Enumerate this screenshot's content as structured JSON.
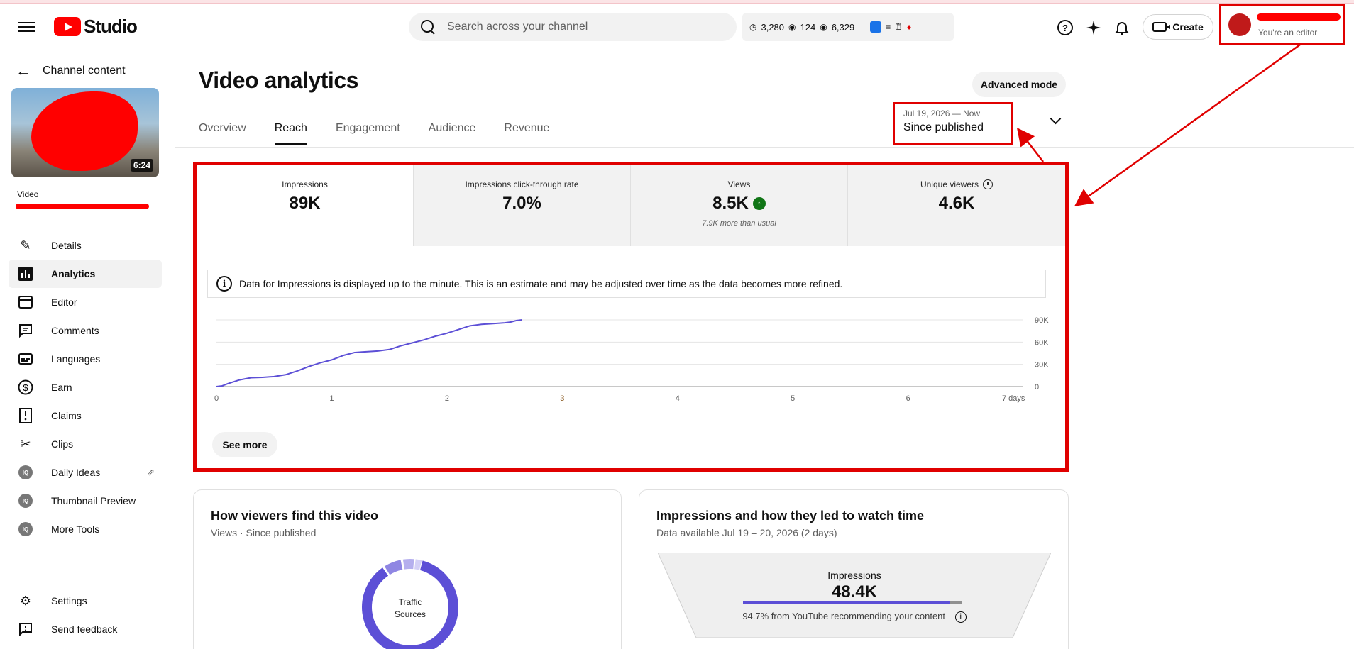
{
  "header": {
    "app_name": "Studio",
    "search_placeholder": "Search across your channel",
    "stats": {
      "watch_hours": "3,280",
      "live_viewers": "124",
      "views": "6,329"
    },
    "create_label": "Create",
    "account_role": "You're an editor"
  },
  "sidebar": {
    "back_label": "Channel content",
    "thumb_duration": "6:24",
    "video_label": "Video",
    "items": [
      {
        "label": "Details",
        "icon": "pencil-icon"
      },
      {
        "label": "Analytics",
        "icon": "analytics-icon"
      },
      {
        "label": "Editor",
        "icon": "editor-icon"
      },
      {
        "label": "Comments",
        "icon": "comments-icon"
      },
      {
        "label": "Languages",
        "icon": "subtitles-icon"
      },
      {
        "label": "Earn",
        "icon": "dollar-icon"
      },
      {
        "label": "Claims",
        "icon": "claims-icon"
      },
      {
        "label": "Clips",
        "icon": "scissors-icon"
      },
      {
        "label": "Daily Ideas",
        "icon": "tool-icon"
      },
      {
        "label": "Thumbnail Preview",
        "icon": "tool-icon"
      },
      {
        "label": "More Tools",
        "icon": "tool-icon"
      }
    ],
    "bottom_items": [
      {
        "label": "Settings",
        "icon": "gear-icon"
      },
      {
        "label": "Send feedback",
        "icon": "feedback-icon"
      }
    ]
  },
  "main": {
    "title": "Video analytics",
    "advanced_mode": "Advanced mode",
    "tabs": [
      "Overview",
      "Reach",
      "Engagement",
      "Audience",
      "Revenue"
    ],
    "active_tab": "Reach",
    "date_range": "Jul 19, 2026 — Now",
    "date_selection": "Since published",
    "metrics": [
      {
        "label": "Impressions",
        "value": "89K",
        "sub": ""
      },
      {
        "label": "Impressions click-through rate",
        "value": "7.0%",
        "sub": ""
      },
      {
        "label": "Views",
        "value": "8.5K",
        "sub": "7.9K more than usual"
      },
      {
        "label": "Unique viewers",
        "value": "4.6K",
        "sub": ""
      }
    ],
    "info_text": "Data for Impressions is displayed up to the minute. This is an estimate and may be adjusted over time as the data becomes more refined.",
    "see_more": "See more"
  },
  "chart_data": {
    "type": "line",
    "title": "",
    "xlabel": "",
    "ylabel": "",
    "x_ticks": [
      "0",
      "1",
      "2",
      "3",
      "4",
      "5",
      "6",
      "7 days"
    ],
    "y_ticks": [
      "0",
      "30K",
      "60K",
      "90K"
    ],
    "xlim": [
      0,
      7
    ],
    "ylim": [
      0,
      90000
    ],
    "series": [
      {
        "x": [
          0,
          0.05,
          0.1,
          0.2,
          0.3,
          0.4,
          0.5,
          0.6,
          0.7,
          0.8,
          0.9,
          1.0,
          1.1,
          1.2,
          1.3,
          1.4,
          1.5,
          1.6,
          1.7,
          1.8,
          1.9,
          2.0,
          2.1,
          2.2,
          2.25,
          2.3,
          2.4,
          2.5,
          2.55,
          2.6,
          2.65
        ],
        "y": [
          0,
          1000,
          4000,
          9000,
          12000,
          12500,
          13500,
          16000,
          21000,
          27000,
          32000,
          36000,
          42000,
          46000,
          47000,
          48000,
          50000,
          55000,
          59000,
          63000,
          68000,
          72000,
          77000,
          82000,
          83000,
          84000,
          85000,
          86000,
          87000,
          89000,
          90000
        ]
      }
    ],
    "grid": true
  },
  "cards": {
    "traffic": {
      "title": "How viewers find this video",
      "subtitle": "Views · Since published",
      "donut_label_1": "Traffic",
      "donut_label_2": "Sources"
    },
    "impressions": {
      "title": "Impressions and how they led to watch time",
      "subtitle": "Data available Jul 19 – 20, 2026 (2 days)",
      "funnel_label": "Impressions",
      "funnel_value": "48.4K",
      "funnel_note": "94.7% from YouTube recommending your content"
    }
  },
  "colors": {
    "accent": "#5c4fd6",
    "annotation": "#e00000",
    "brand": "#ff0000",
    "up": "#107516"
  }
}
